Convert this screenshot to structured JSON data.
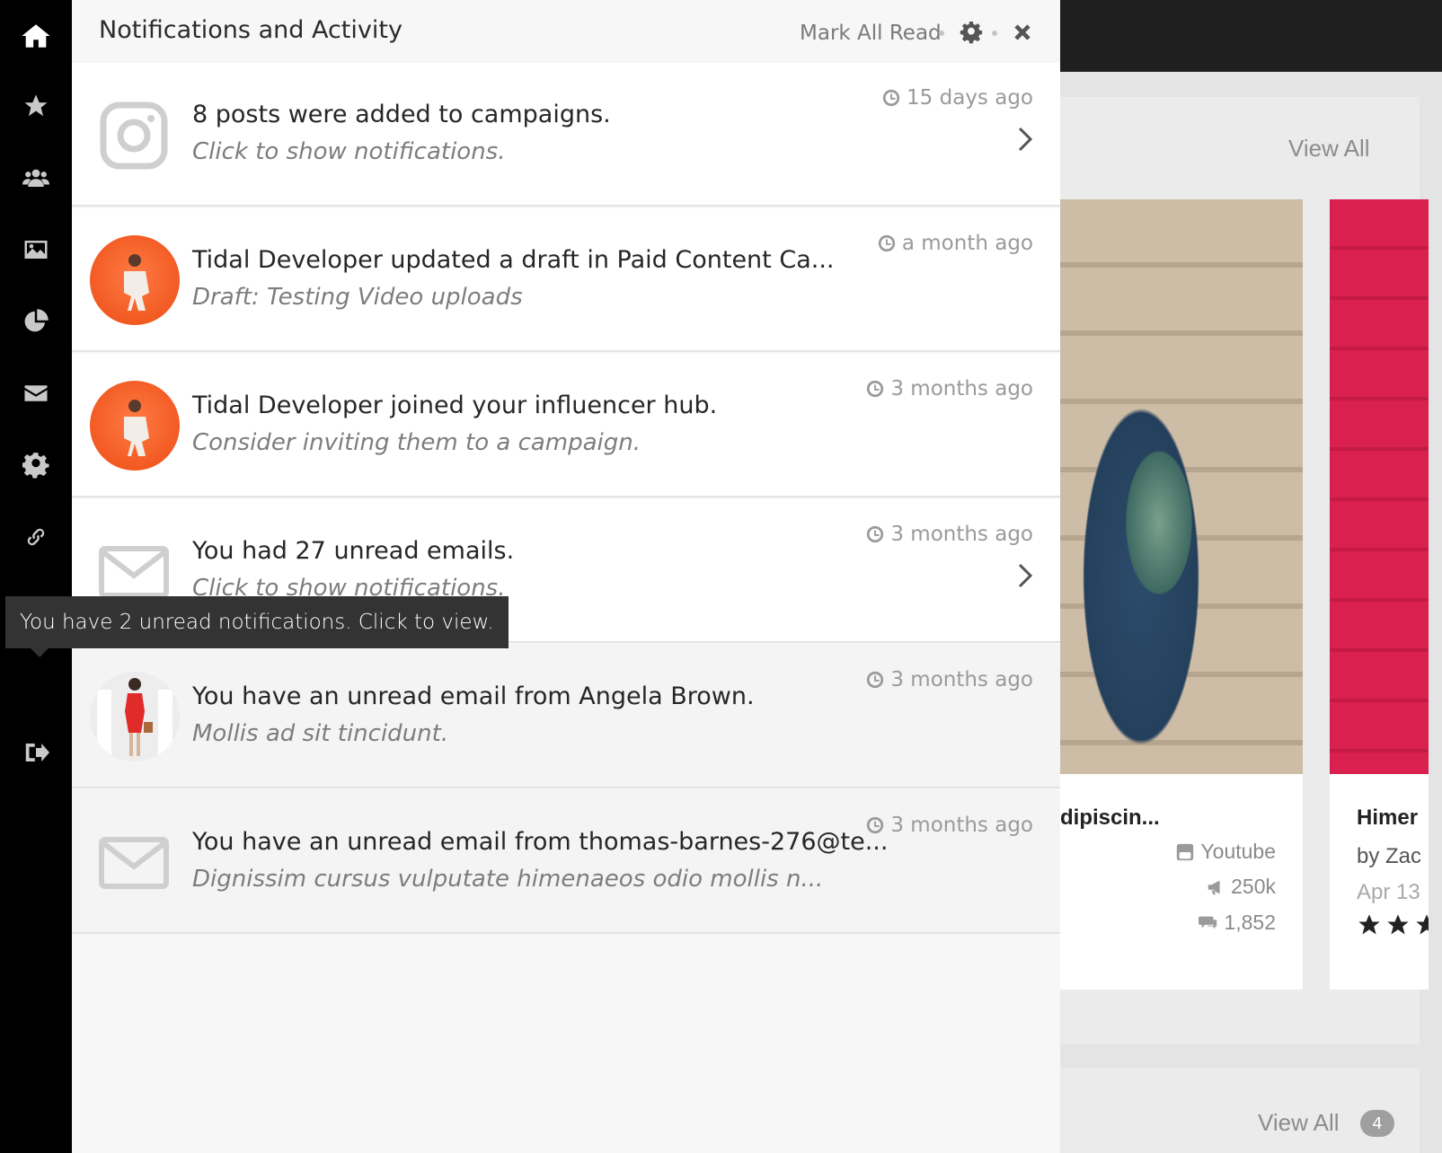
{
  "sidebar": {
    "items": [
      {
        "icon": "home-icon",
        "name": "sidebar-item-home"
      },
      {
        "icon": "star-icon",
        "name": "sidebar-item-favorites"
      },
      {
        "icon": "users-icon",
        "name": "sidebar-item-influencers"
      },
      {
        "icon": "image-icon",
        "name": "sidebar-item-content"
      },
      {
        "icon": "pie-chart-icon",
        "name": "sidebar-item-reports"
      },
      {
        "icon": "envelope-icon",
        "name": "sidebar-item-messages"
      },
      {
        "icon": "gear-icon",
        "name": "sidebar-item-settings"
      },
      {
        "icon": "link-icon",
        "name": "sidebar-item-links"
      },
      {
        "icon": "sign-out-icon",
        "name": "sidebar-item-logout"
      }
    ],
    "notification_count": "2",
    "tooltip": "You have 2 unread notifications. Click to view."
  },
  "panel": {
    "title": "Notifications and Activity",
    "mark_all_read": "Mark All Read",
    "notifications": [
      {
        "title": "8 posts were added to campaigns.",
        "subtitle": "Click to show notifications.",
        "time": "15 days ago",
        "icon": "instagram-icon",
        "has_chevron": true,
        "state": "read"
      },
      {
        "title": "Tidal Developer updated a draft in Paid Content Ca...",
        "subtitle": "Draft: Testing Video uploads",
        "time": "a month ago",
        "icon": "avatar",
        "has_chevron": false,
        "state": "read"
      },
      {
        "title": "Tidal Developer joined your influencer hub.",
        "subtitle": "Consider inviting them to a campaign.",
        "time": "3 months ago",
        "icon": "avatar",
        "has_chevron": false,
        "state": "read"
      },
      {
        "title": "You had 27 unread emails.",
        "subtitle": "Click to show notifications.",
        "time": "3 months ago",
        "icon": "envelope-icon",
        "has_chevron": true,
        "state": "read"
      },
      {
        "title": "You have an unread email from Angela Brown.",
        "subtitle": "Mollis ad sit tincidunt.",
        "time": "3 months ago",
        "icon": "avatar",
        "has_chevron": false,
        "state": "unread"
      },
      {
        "title": "You have an unread email from thomas-barnes-276@te...",
        "subtitle": "Dignissim cursus vulputate himenaeos odio mollis n...",
        "time": "3 months ago",
        "icon": "envelope-icon",
        "has_chevron": false,
        "state": "unread"
      }
    ]
  },
  "background": {
    "view_all_top": "View All",
    "card1": {
      "title": "dipiscin...",
      "platform": "Youtube",
      "reach": "250k",
      "comments": "1,852"
    },
    "card2": {
      "title": "Himer",
      "byline": "by Zac",
      "date": "Apr 13"
    },
    "view_all_bottom": "View All",
    "view_all_count": "4"
  },
  "colors": {
    "badge": "#4fbe12",
    "sidebar": "#000000",
    "tooltip": "#333333"
  }
}
